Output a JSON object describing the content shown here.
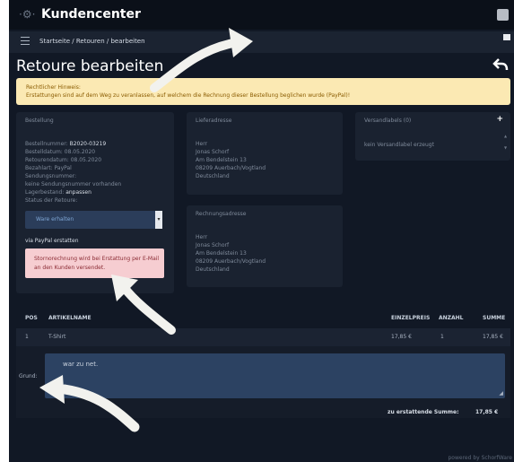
{
  "app": {
    "title": "Kundencenter"
  },
  "nav": {
    "breadcrumb": "Startseite / Retouren / bearbeiten"
  },
  "page": {
    "title": "Retoure bearbeiten"
  },
  "notice": {
    "title": "Rechtlicher Hinweis:",
    "text": "Erstattungen sind auf dem Weg zu veranlassen, auf welchem die Rechnung dieser Bestellung beglichen wurde (PayPal)!"
  },
  "order": {
    "label": "Bestellung",
    "number_label": "Bestellnummer:",
    "number": "B2020-03219",
    "order_date_label": "Bestelldatum:",
    "order_date": "08.05.2020",
    "return_date_label": "Retourendatum:",
    "return_date": "08.05.2020",
    "payment_label": "Bezahlart:",
    "payment": "PayPal",
    "tracking_label": "Sendungsnummer:",
    "tracking_value": "keine Sendungsnummer vorhanden",
    "stock_label": "Lagerbestand:",
    "stock": "anpassen",
    "status_label": "Status der Retoure:",
    "status_value": "Ware erhalten",
    "paypal_action": "via PayPal erstatten",
    "alert": "Stornorechnung wird bei Erstattung per E-Mail an den Kunden versendet."
  },
  "delivery": {
    "label": "Lieferadresse",
    "lines": [
      "Herr",
      "Jonas Schorf",
      "Am Bendelstein 13",
      "08209 Auerbach/Vogtland",
      "Deutschland"
    ]
  },
  "billing": {
    "label": "Rechnungsadresse",
    "lines": [
      "Herr",
      "Jonas Schorf",
      "Am Bendelstein 13",
      "08209 Auerbach/Vogtland",
      "Deutschland"
    ]
  },
  "labels": {
    "title": "Versandlabels (0)",
    "empty": "kein Versandlabel erzeugt"
  },
  "table": {
    "headers": [
      "POS",
      "ARTIKELNAME",
      "EINZELPREIS",
      "ANZAHL",
      "SUMME"
    ],
    "rows": [
      {
        "pos": "1",
        "name": "T-Shirt",
        "price": "17,85 €",
        "qty": "1",
        "sum": "17,85 €"
      }
    ]
  },
  "reason": {
    "label": "Grund:",
    "value": "war zu net."
  },
  "total": {
    "label": "zu erstattende Summe:",
    "value": "17,85 €"
  },
  "footer": {
    "text": "powered by SchorfWare"
  },
  "colors": {
    "background": "#111825",
    "panel": "#1a2230",
    "notice": "#fbe9b3",
    "alert": "#f6cdd1",
    "input": "#2c4262"
  }
}
